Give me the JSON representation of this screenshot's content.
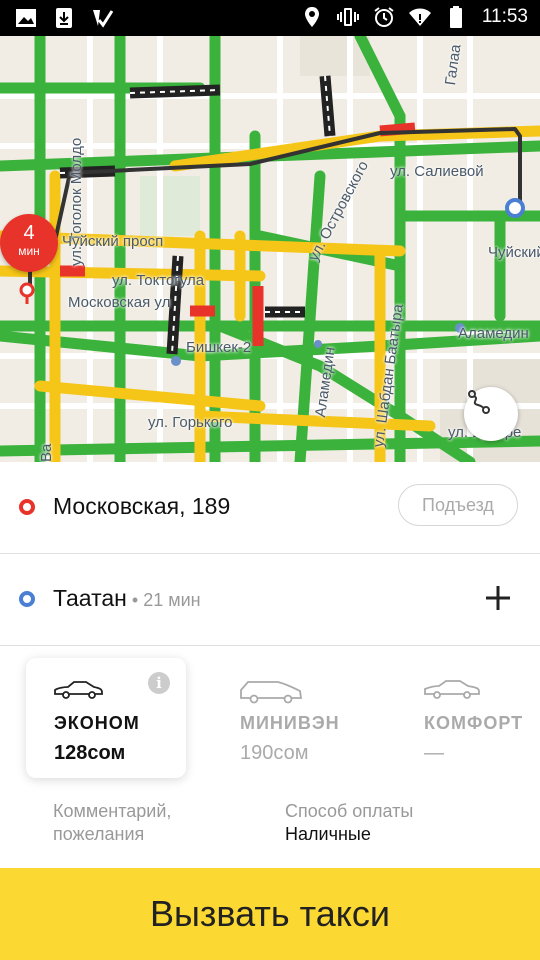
{
  "status_bar": {
    "time": "11:53",
    "left_icons": [
      "gallery-icon",
      "download-icon",
      "check-app-icon"
    ],
    "right_icons": [
      "location-icon",
      "vibrate-icon",
      "alarm-icon",
      "wifi-icon",
      "battery-icon"
    ]
  },
  "map": {
    "eta": {
      "value": "4",
      "unit": "мин"
    },
    "street_labels": [
      "ул. Тоголок Молдо",
      "Чуйский просп",
      "ул. Токтогула",
      "Московская ул",
      "Бишкек-2",
      "ул. Горького",
      "ул. Салиевой",
      "ул. Островского",
      "Аламедин",
      "ул. Шабдан Баатыра",
      "Чуйский",
      "ул. Уркаре",
      "Аламедин",
      "Ва",
      "Галаа"
    ],
    "route_button_icon": "route-icon",
    "colors": {
      "traffic_free": "#3bb23b",
      "traffic_medium": "#f5c518",
      "traffic_jam": "#e8332a",
      "route": "#333333"
    }
  },
  "pickup": {
    "address": "Московская, 189",
    "entrance_button": "Подъезд",
    "pin_color": "#e8332a"
  },
  "destination": {
    "address": "Таатан",
    "separator": " • ",
    "duration": "21 мин",
    "add_icon": "plus-icon",
    "pin_color": "#4a7fd4"
  },
  "tariffs": [
    {
      "name": "ЭКОНОМ",
      "price": "128сом",
      "selected": true
    },
    {
      "name": "МИНИВЭН",
      "price": "190сом",
      "selected": false
    },
    {
      "name": "КОМФОРТ",
      "price": "—",
      "selected": false
    }
  ],
  "options": {
    "comment_label": "Комментарий,\nпожелания",
    "comment_line1": "Комментарий,",
    "comment_line2": "пожелания",
    "payment_label": "Способ оплаты",
    "payment_value": "Наличные"
  },
  "call_button": {
    "label": "Вызвать такси",
    "color": "#fcd932"
  }
}
